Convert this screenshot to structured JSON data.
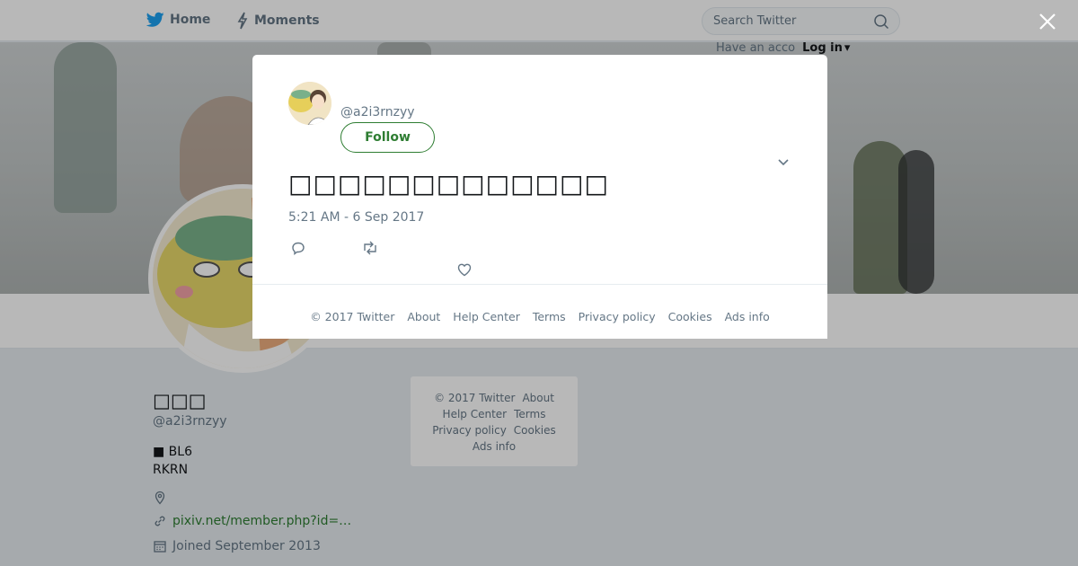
{
  "colors": {
    "accent": "#2e7d32",
    "muted": "#657786",
    "text": "#14171a",
    "background": "#e6ecf0"
  },
  "nav": {
    "home_label": "Home",
    "moments_label": "Moments",
    "search_placeholder": "Search Twitter",
    "have_account": "Have an acco",
    "login_label": "Log in"
  },
  "profile": {
    "name": "□□□",
    "handle": "@a2i3rnzyy",
    "bio_line1": "■ BL6",
    "bio_line2": "RKRN",
    "link": "pixiv.net/member.php?id=…",
    "joined": "Joined September 2013"
  },
  "side_footer": {
    "copyright": "© 2017 Twitter",
    "about": "About",
    "help": "Help Center",
    "terms": "Terms",
    "privacy": "Privacy policy",
    "cookies": "Cookies",
    "ads": "Ads info"
  },
  "tweet": {
    "handle": "@a2i3rnzyy",
    "follow_label": "Follow",
    "text": "□□□□□□□□□□□□□",
    "timestamp": "5:21 AM - 6 Sep 2017"
  },
  "modal_footer": {
    "copyright": "© 2017 Twitter",
    "about": "About",
    "help": "Help Center",
    "terms": "Terms",
    "privacy": "Privacy policy",
    "cookies": "Cookies",
    "ads": "Ads info"
  }
}
